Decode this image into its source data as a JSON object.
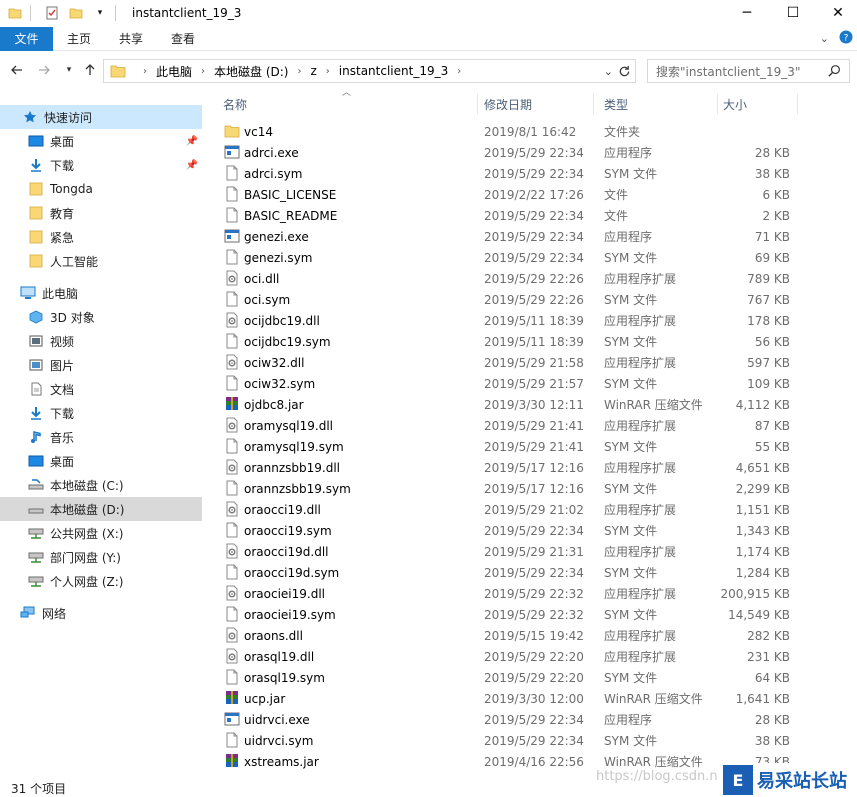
{
  "window": {
    "title": "instantclient_19_3",
    "minimize": "─",
    "maximize": "☐",
    "close": "✕"
  },
  "ribbon": {
    "tabs": [
      "文件",
      "主页",
      "共享",
      "查看"
    ]
  },
  "address": {
    "crumbs": [
      "此电脑",
      "本地磁盘 (D:)",
      "z",
      "instantclient_19_3"
    ],
    "search_placeholder": "搜索\"instantclient_19_3\""
  },
  "sidebar": {
    "items": [
      {
        "label": "快速访问",
        "icon": "star-icon"
      },
      {
        "label": "桌面",
        "icon": "desktop-icon"
      },
      {
        "label": "下载",
        "icon": "download-icon"
      },
      {
        "label": "Tongda",
        "icon": "folder-icon"
      },
      {
        "label": "教育",
        "icon": "folder-icon"
      },
      {
        "label": "紧急",
        "icon": "folder-icon"
      },
      {
        "label": "人工智能",
        "icon": "folder-icon"
      },
      {
        "label": "此电脑",
        "icon": "computer-icon"
      },
      {
        "label": "3D 对象",
        "icon": "cube-icon"
      },
      {
        "label": "视频",
        "icon": "video-icon"
      },
      {
        "label": "图片",
        "icon": "picture-icon"
      },
      {
        "label": "文档",
        "icon": "document-icon"
      },
      {
        "label": "下载",
        "icon": "download-icon"
      },
      {
        "label": "音乐",
        "icon": "music-icon"
      },
      {
        "label": "桌面",
        "icon": "desktop-icon"
      },
      {
        "label": "本地磁盘 (C:)",
        "icon": "drive-icon"
      },
      {
        "label": "本地磁盘 (D:)",
        "icon": "drive-icon"
      },
      {
        "label": "公共网盘 (X:)",
        "icon": "network-drive-icon"
      },
      {
        "label": "部门网盘 (Y:)",
        "icon": "network-drive-icon"
      },
      {
        "label": "个人网盘 (Z:)",
        "icon": "network-drive-icon"
      },
      {
        "label": "网络",
        "icon": "network-icon"
      }
    ]
  },
  "columns": {
    "name": "名称",
    "date": "修改日期",
    "type": "类型",
    "size": "大小"
  },
  "files": [
    {
      "name": "vc14",
      "date": "2019/8/1 16:42",
      "type": "文件夹",
      "size": "",
      "icon": "folder-icon"
    },
    {
      "name": "adrci.exe",
      "date": "2019/5/29 22:34",
      "type": "应用程序",
      "size": "28 KB",
      "icon": "exe-icon"
    },
    {
      "name": "adrci.sym",
      "date": "2019/5/29 22:34",
      "type": "SYM 文件",
      "size": "38 KB",
      "icon": "file-icon"
    },
    {
      "name": "BASIC_LICENSE",
      "date": "2019/2/22 17:26",
      "type": "文件",
      "size": "6 KB",
      "icon": "file-icon"
    },
    {
      "name": "BASIC_README",
      "date": "2019/5/29 22:34",
      "type": "文件",
      "size": "2 KB",
      "icon": "file-icon"
    },
    {
      "name": "genezi.exe",
      "date": "2019/5/29 22:34",
      "type": "应用程序",
      "size": "71 KB",
      "icon": "exe-icon"
    },
    {
      "name": "genezi.sym",
      "date": "2019/5/29 22:34",
      "type": "SYM 文件",
      "size": "69 KB",
      "icon": "file-icon"
    },
    {
      "name": "oci.dll",
      "date": "2019/5/29 22:26",
      "type": "应用程序扩展",
      "size": "789 KB",
      "icon": "dll-icon"
    },
    {
      "name": "oci.sym",
      "date": "2019/5/29 22:26",
      "type": "SYM 文件",
      "size": "767 KB",
      "icon": "file-icon"
    },
    {
      "name": "ocijdbc19.dll",
      "date": "2019/5/11 18:39",
      "type": "应用程序扩展",
      "size": "178 KB",
      "icon": "dll-icon"
    },
    {
      "name": "ocijdbc19.sym",
      "date": "2019/5/11 18:39",
      "type": "SYM 文件",
      "size": "56 KB",
      "icon": "file-icon"
    },
    {
      "name": "ociw32.dll",
      "date": "2019/5/29 21:58",
      "type": "应用程序扩展",
      "size": "597 KB",
      "icon": "dll-icon"
    },
    {
      "name": "ociw32.sym",
      "date": "2019/5/29 21:57",
      "type": "SYM 文件",
      "size": "109 KB",
      "icon": "file-icon"
    },
    {
      "name": "ojdbc8.jar",
      "date": "2019/3/30 12:11",
      "type": "WinRAR 压缩文件",
      "size": "4,112 KB",
      "icon": "winrar-icon"
    },
    {
      "name": "oramysql19.dll",
      "date": "2019/5/29 21:41",
      "type": "应用程序扩展",
      "size": "87 KB",
      "icon": "dll-icon"
    },
    {
      "name": "oramysql19.sym",
      "date": "2019/5/29 21:41",
      "type": "SYM 文件",
      "size": "55 KB",
      "icon": "file-icon"
    },
    {
      "name": "orannzsbb19.dll",
      "date": "2019/5/17 12:16",
      "type": "应用程序扩展",
      "size": "4,651 KB",
      "icon": "dll-icon"
    },
    {
      "name": "orannzsbb19.sym",
      "date": "2019/5/17 12:16",
      "type": "SYM 文件",
      "size": "2,299 KB",
      "icon": "file-icon"
    },
    {
      "name": "oraocci19.dll",
      "date": "2019/5/29 21:02",
      "type": "应用程序扩展",
      "size": "1,151 KB",
      "icon": "dll-icon"
    },
    {
      "name": "oraocci19.sym",
      "date": "2019/5/29 22:34",
      "type": "SYM 文件",
      "size": "1,343 KB",
      "icon": "file-icon"
    },
    {
      "name": "oraocci19d.dll",
      "date": "2019/5/29 21:31",
      "type": "应用程序扩展",
      "size": "1,174 KB",
      "icon": "dll-icon"
    },
    {
      "name": "oraocci19d.sym",
      "date": "2019/5/29 22:34",
      "type": "SYM 文件",
      "size": "1,284 KB",
      "icon": "file-icon"
    },
    {
      "name": "oraociei19.dll",
      "date": "2019/5/29 22:32",
      "type": "应用程序扩展",
      "size": "200,915 KB",
      "icon": "dll-icon"
    },
    {
      "name": "oraociei19.sym",
      "date": "2019/5/29 22:32",
      "type": "SYM 文件",
      "size": "14,549 KB",
      "icon": "file-icon"
    },
    {
      "name": "oraons.dll",
      "date": "2019/5/15 19:42",
      "type": "应用程序扩展",
      "size": "282 KB",
      "icon": "dll-icon"
    },
    {
      "name": "orasql19.dll",
      "date": "2019/5/29 22:20",
      "type": "应用程序扩展",
      "size": "231 KB",
      "icon": "dll-icon"
    },
    {
      "name": "orasql19.sym",
      "date": "2019/5/29 22:20",
      "type": "SYM 文件",
      "size": "64 KB",
      "icon": "file-icon"
    },
    {
      "name": "ucp.jar",
      "date": "2019/3/30 12:00",
      "type": "WinRAR 压缩文件",
      "size": "1,641 KB",
      "icon": "winrar-icon"
    },
    {
      "name": "uidrvci.exe",
      "date": "2019/5/29 22:34",
      "type": "应用程序",
      "size": "28 KB",
      "icon": "exe-icon"
    },
    {
      "name": "uidrvci.sym",
      "date": "2019/5/29 22:34",
      "type": "SYM 文件",
      "size": "38 KB",
      "icon": "file-icon"
    },
    {
      "name": "xstreams.jar",
      "date": "2019/4/16 22:56",
      "type": "WinRAR 压缩文件",
      "size": "73 KB",
      "icon": "winrar-icon"
    }
  ],
  "status": {
    "item_count": "31 个项目"
  },
  "watermark": {
    "url": "https://blog.csdn.n",
    "logo_mark": "E",
    "logo_text": "易采站长站"
  }
}
